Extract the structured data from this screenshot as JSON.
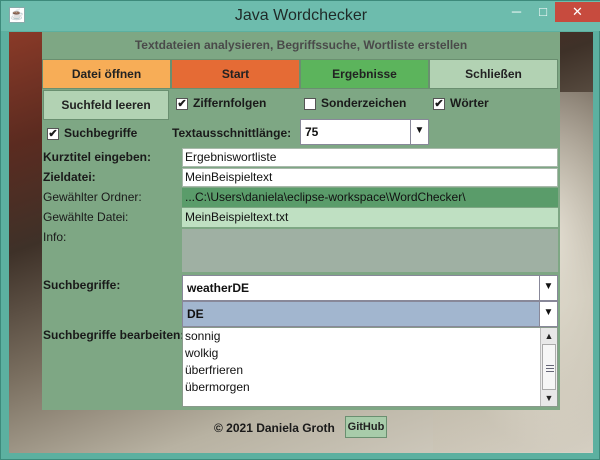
{
  "window": {
    "title": "Java Wordchecker",
    "min": "─",
    "max": "□",
    "close": "✕"
  },
  "heading": "Textdateien analysieren, Begriffssuche, Wortliste erstellen",
  "toolbar": [
    {
      "label": "Datei öffnen",
      "color": "#f7ad57"
    },
    {
      "label": "Start",
      "color": "#e56b35"
    },
    {
      "label": "Ergebnisse",
      "color": "#5cb45c"
    },
    {
      "label": "Schließen",
      "color": "#b2d2b3"
    }
  ],
  "options": {
    "clear_button": "Suchfeld leeren",
    "digits": {
      "label": "Ziffernfolgen",
      "checked": true
    },
    "special": {
      "label": "Sonderzeichen",
      "checked": false
    },
    "words": {
      "label": "Wörter",
      "checked": true
    },
    "search_terms": {
      "label": "Suchbegriffe",
      "checked": true
    },
    "excerpt_length_label": "Textausschnittlänge:",
    "excerpt_length_value": "75"
  },
  "fields": {
    "short_title_label": "Kurztitel eingeben:",
    "short_title_value": "Ergebniswortliste",
    "target_label": "Zieldatei:",
    "target_value": "MeinBeispieltext",
    "folder_label": "Gewählter Ordner:",
    "folder_value": "...C:\\Users\\daniela\\eclipse-workspace\\WordChecker\\",
    "file_label": "Gewählte Datei:",
    "file_value": "MeinBeispieltext.txt",
    "info_label": "Info:"
  },
  "search": {
    "label": "Suchbegriffe:",
    "list_value": "weatherDE",
    "lang_value": "DE",
    "edit_label": "Suchbegriffe bearbeiten:",
    "terms": [
      "sonnig",
      "wolkig",
      "überfrieren",
      "übermorgen"
    ]
  },
  "footer": {
    "copyright": "© 2021 Daniela Groth",
    "github": "GitHub"
  },
  "icons": {
    "check": "✔",
    "arrow_down": "▼",
    "arrow_up": "▲",
    "app": "☕"
  }
}
